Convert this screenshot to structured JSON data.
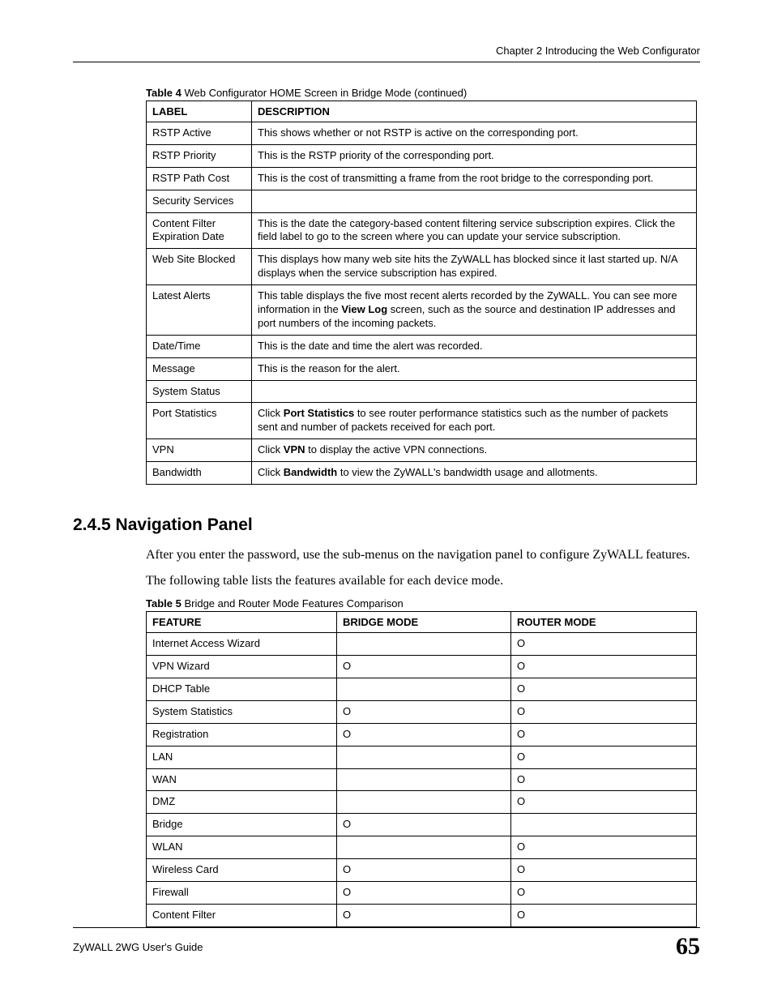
{
  "header": "Chapter 2 Introducing the Web Configurator",
  "table4": {
    "caption_bold": "Table 4",
    "caption_rest": "   Web Configurator HOME Screen in Bridge Mode (continued)",
    "headers": [
      "LABEL",
      "DESCRIPTION"
    ],
    "rows": [
      {
        "label": "RSTP Active",
        "desc": [
          {
            "t": "This shows whether or not RSTP is active on the corresponding port."
          }
        ]
      },
      {
        "label": "RSTP Priority",
        "desc": [
          {
            "t": "This is the RSTP priority of the corresponding port."
          }
        ]
      },
      {
        "label": "RSTP Path Cost",
        "desc": [
          {
            "t": "This is the cost of transmitting a frame from the root bridge to the corresponding port."
          }
        ]
      },
      {
        "label": "Security Services",
        "desc": [
          {
            "t": ""
          }
        ]
      },
      {
        "label": "Content Filter Expiration Date",
        "desc": [
          {
            "t": "This is the date the category-based content filtering service subscription expires. Click the field label to go to the screen where you can update your service subscription."
          }
        ]
      },
      {
        "label": "Web Site Blocked",
        "desc": [
          {
            "t": "This displays how many web site hits the ZyWALL has blocked since it last started up. N/A displays when the service subscription has expired."
          }
        ]
      },
      {
        "label": "Latest Alerts",
        "desc": [
          {
            "t": "This table displays the five most recent alerts recorded by the ZyWALL. You can see more information in the "
          },
          {
            "b": "View Log"
          },
          {
            "t": " screen, such as the source and destination IP addresses and port numbers of the incoming packets."
          }
        ]
      },
      {
        "label": "Date/Time",
        "desc": [
          {
            "t": "This is the date and time the alert was recorded."
          }
        ]
      },
      {
        "label": "Message",
        "desc": [
          {
            "t": "This is the reason for the alert."
          }
        ]
      },
      {
        "label": "System Status",
        "desc": [
          {
            "t": ""
          }
        ]
      },
      {
        "label": "Port Statistics",
        "desc": [
          {
            "t": "Click "
          },
          {
            "b": "Port Statistics"
          },
          {
            "t": " to see router performance statistics such as the number of packets sent and number of packets received for each port."
          }
        ]
      },
      {
        "label": "VPN",
        "desc": [
          {
            "t": "Click "
          },
          {
            "b": "VPN"
          },
          {
            "t": " to display the active VPN connections."
          }
        ]
      },
      {
        "label": "Bandwidth",
        "desc": [
          {
            "t": "Click "
          },
          {
            "b": "Bandwidth"
          },
          {
            "t": " to view the ZyWALL's bandwidth usage and allotments."
          }
        ]
      }
    ]
  },
  "section": {
    "title": "2.4.5  Navigation Panel",
    "para1": "After you enter the password, use the sub-menus on the navigation panel to configure ZyWALL features.",
    "para2": "The following table lists the features available for each device mode."
  },
  "table5": {
    "caption_bold": "Table 5",
    "caption_rest": "   Bridge and Router Mode Features Comparison",
    "headers": [
      "FEATURE",
      "BRIDGE MODE",
      "ROUTER MODE"
    ],
    "rows": [
      {
        "feature": "Internet Access Wizard",
        "bridge": "",
        "router": "O"
      },
      {
        "feature": "VPN Wizard",
        "bridge": "O",
        "router": "O"
      },
      {
        "feature": "DHCP Table",
        "bridge": "",
        "router": "O"
      },
      {
        "feature": "System Statistics",
        "bridge": "O",
        "router": "O"
      },
      {
        "feature": "Registration",
        "bridge": "O",
        "router": "O"
      },
      {
        "feature": "LAN",
        "bridge": "",
        "router": "O"
      },
      {
        "feature": "WAN",
        "bridge": "",
        "router": "O"
      },
      {
        "feature": "DMZ",
        "bridge": "",
        "router": "O"
      },
      {
        "feature": "Bridge",
        "bridge": "O",
        "router": ""
      },
      {
        "feature": "WLAN",
        "bridge": "",
        "router": "O"
      },
      {
        "feature": "Wireless Card",
        "bridge": "O",
        "router": "O"
      },
      {
        "feature": "Firewall",
        "bridge": "O",
        "router": "O"
      },
      {
        "feature": "Content Filter",
        "bridge": "O",
        "router": "O"
      }
    ]
  },
  "footer": {
    "left": "ZyWALL 2WG User's Guide",
    "right": "65"
  }
}
